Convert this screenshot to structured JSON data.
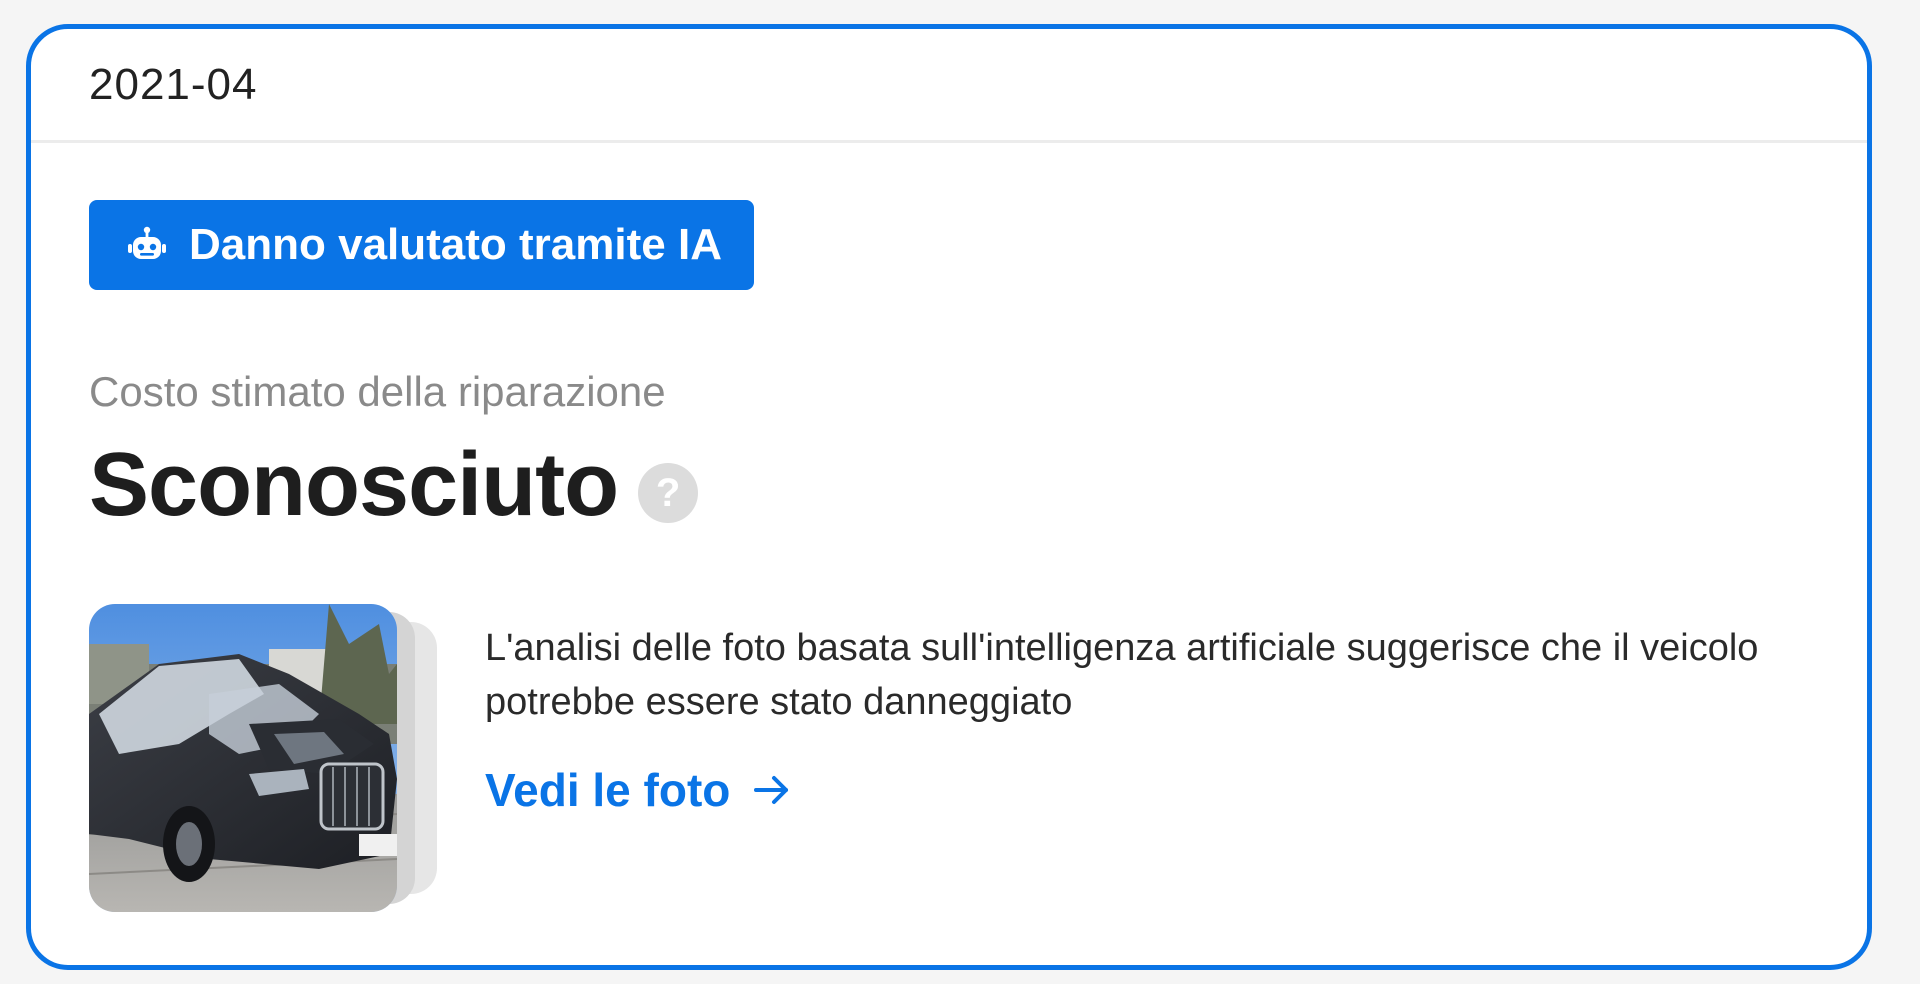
{
  "card": {
    "date": "2021-04"
  },
  "badge": {
    "icon": "robot-icon",
    "label": "Danno valutato tramite IA"
  },
  "cost": {
    "label": "Costo stimato della riparazione",
    "value": "Sconosciuto",
    "help_icon": "question-icon",
    "help_glyph": "?"
  },
  "analysis": {
    "description": "L'analisi delle foto basata sull'intelligenza artificiale suggerisce che il veicolo potrebbe essere stato danneggiato",
    "link_label": "Vedi le foto",
    "link_icon": "arrow-right-icon"
  },
  "colors": {
    "accent": "#0a74e6",
    "muted_text": "#8a8a8a",
    "help_icon_bg": "#dcdcdc"
  }
}
